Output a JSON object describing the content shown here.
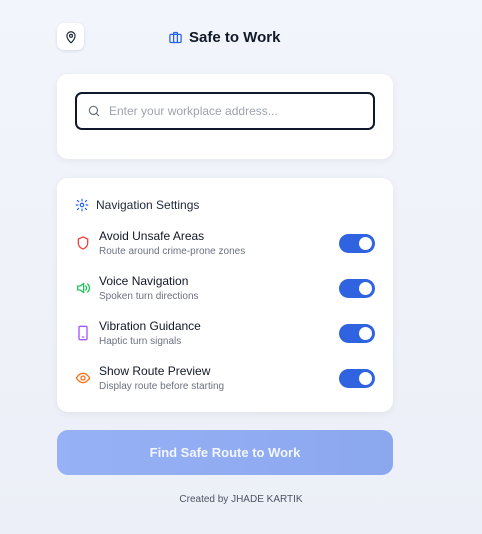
{
  "header": {
    "title": "Safe to Work",
    "location_icon": "map-pin-icon",
    "title_icon": "briefcase-icon"
  },
  "search": {
    "placeholder": "Enter your workplace address...",
    "value": "",
    "icon": "search-icon"
  },
  "settings": {
    "title": "Navigation Settings",
    "icon": "gear-icon",
    "items": [
      {
        "label": "Avoid Unsafe Areas",
        "description": "Route around crime-prone zones",
        "icon": "shield-icon",
        "icon_color": "#ef4444",
        "enabled": true
      },
      {
        "label": "Voice Navigation",
        "description": "Spoken turn directions",
        "icon": "speaker-icon",
        "icon_color": "#22c55e",
        "enabled": true
      },
      {
        "label": "Vibration Guidance",
        "description": "Haptic turn signals",
        "icon": "phone-icon",
        "icon_color": "#a855f7",
        "enabled": true
      },
      {
        "label": "Show Route Preview",
        "description": "Display route before starting",
        "icon": "eye-icon",
        "icon_color": "#f97316",
        "enabled": true
      }
    ]
  },
  "cta": {
    "label": "Find Safe Route to Work"
  },
  "footer": {
    "text": "Created by JHADE KARTIK"
  },
  "colors": {
    "accent": "#2f63e0",
    "title_icon": "#2563eb"
  }
}
